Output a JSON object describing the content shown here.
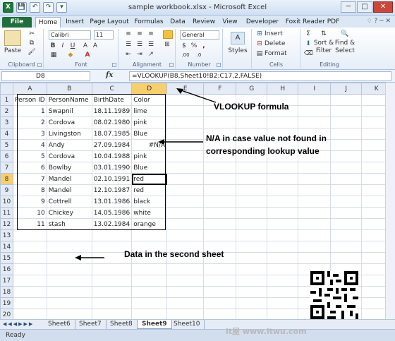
{
  "window": {
    "title": "sample workbook.xlsx - Microsoft Excel",
    "qat": [
      "X",
      "💾",
      "↶",
      "↷",
      "▾"
    ],
    "buttons": [
      "─",
      "□",
      "✕"
    ]
  },
  "tabs": [
    "File",
    "Home",
    "Insert",
    "Page Layout",
    "Formulas",
    "Data",
    "Review",
    "View",
    "Developer",
    "Foxit Reader PDF"
  ],
  "ribbon": {
    "paste_label": "Paste",
    "font_name": "Calibri",
    "font_size": "11",
    "number_format": "General",
    "styles_label": "Styles",
    "insert_label": "Insert",
    "delete_label": "Delete",
    "format_label": "Format",
    "sort_label": "Sort &",
    "filter_label": "Filter",
    "find_label": "Find &",
    "select_label": "Select",
    "groups": [
      "Clipboard",
      "Font",
      "Alignment",
      "Number",
      "Cells",
      "Editing"
    ]
  },
  "formula_bar": {
    "cell_ref": "D8",
    "fx": "fx",
    "formula": "=VLOOKUP(B8,Sheet10!B2:C17,2,FALSE)"
  },
  "columns": [
    "A",
    "B",
    "C",
    "D",
    "E",
    "F",
    "G",
    "H",
    "I",
    "J",
    "K"
  ],
  "rows": [
    [
      "Person ID",
      "PersonName",
      "BirthDate",
      "Color"
    ],
    [
      "1",
      "Swapnil",
      "18.11.1989",
      "lime"
    ],
    [
      "2",
      "Cordova",
      "08.02.1980",
      "pink"
    ],
    [
      "3",
      "Livingston",
      "18.07.1985",
      "Blue"
    ],
    [
      "4",
      "Andy",
      "27.09.1984",
      "#N/A"
    ],
    [
      "5",
      "Cordova",
      "10.04.1988",
      "pink"
    ],
    [
      "6",
      "Bowlby",
      "03.01.1990",
      "Blue"
    ],
    [
      "7",
      "Mandel",
      "02.10.1991",
      "red"
    ],
    [
      "8",
      "Mandel",
      "12.10.1987",
      "red"
    ],
    [
      "9",
      "Cottrell",
      "13.01.1986",
      "black"
    ],
    [
      "10",
      "Chickey",
      "14.05.1986",
      "white"
    ],
    [
      "11",
      "stash",
      "13.02.1984",
      "orange"
    ],
    [
      "",
      "",
      "",
      ""
    ],
    [
      "",
      "",
      "",
      ""
    ],
    [
      "",
      "",
      "",
      ""
    ],
    [
      "",
      "",
      "",
      ""
    ],
    [
      "",
      "",
      "",
      ""
    ],
    [
      "",
      "",
      "",
      ""
    ],
    [
      "",
      "",
      "",
      ""
    ],
    [
      "",
      "",
      "",
      ""
    ]
  ],
  "annotations": {
    "vlookup": "VLOOKUP formula",
    "na_line1": "N/A in case value not found in",
    "na_line2": "corresponding lookup value",
    "second_sheet": "Data in the second sheet"
  },
  "sheets": [
    "Sheet6",
    "Sheet7",
    "Sheet8",
    "Sheet9",
    "Sheet10"
  ],
  "active_sheet": "Sheet9",
  "status": "Ready",
  "watermark": "it屋 www.itwu.com"
}
